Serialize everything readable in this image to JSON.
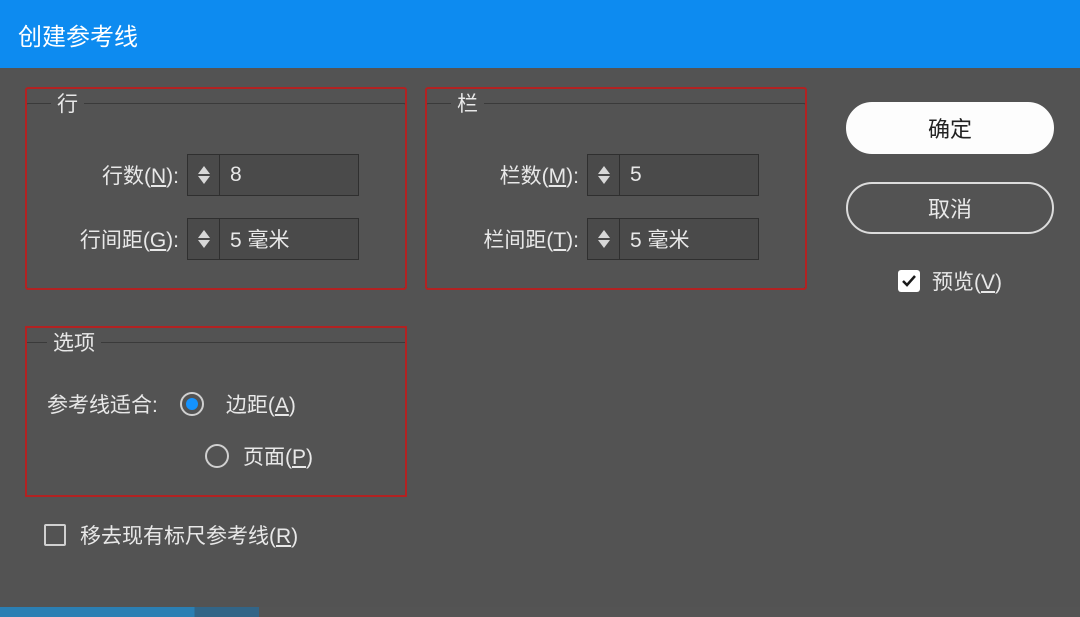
{
  "titlebar": {
    "title": "创建参考线"
  },
  "rows_group": {
    "legend": "行",
    "count_label": "行数(N):",
    "count_value": "8",
    "gap_label": "行间距(G):",
    "gap_value": "5 毫米"
  },
  "cols_group": {
    "legend": "栏",
    "count_label": "栏数(M):",
    "count_value": "5",
    "gap_label": "栏间距(T):",
    "gap_value": "5 毫米"
  },
  "options_group": {
    "legend": "选项",
    "fit_label": "参考线适合:",
    "radio_margin": "边距(A)",
    "radio_page": "页面(P)",
    "remove_label": "移去现有标尺参考线(R)"
  },
  "buttons": {
    "ok": "确定",
    "cancel": "取消",
    "preview": "预览(V)"
  }
}
